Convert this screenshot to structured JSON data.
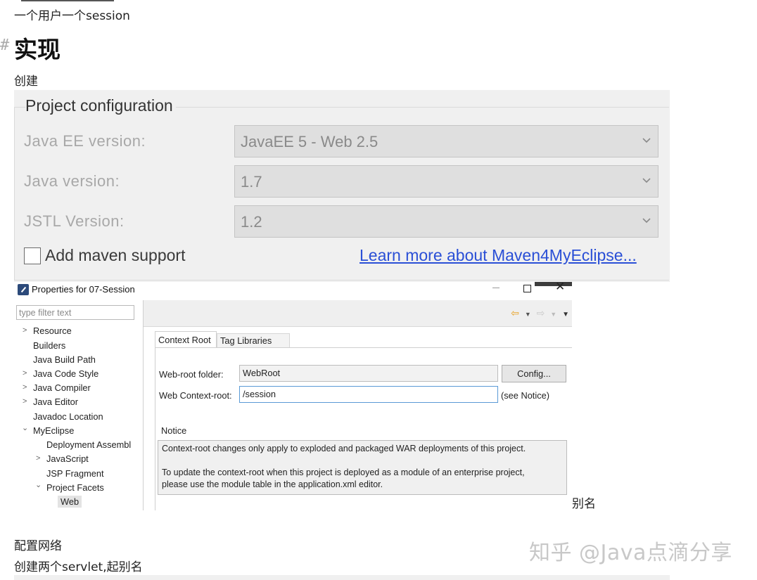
{
  "article": {
    "line_top": "一个用户一个session",
    "heading_hash": "#",
    "heading": "实现",
    "create": "创建",
    "alias_suffix": "别名",
    "configure_network": "配置网络",
    "create_servlets": "创建两个servlet,起别名",
    "watermark": "知乎 @Java点滴分享"
  },
  "project_config": {
    "title": "Project configuration",
    "rows": [
      {
        "label": "Java EE version:",
        "value": "JavaEE 5 - Web 2.5"
      },
      {
        "label": "Java version:",
        "value": "1.7"
      },
      {
        "label": "JSTL Version:",
        "value": "1.2"
      }
    ],
    "maven_checkbox_label": "Add maven support",
    "maven_checked": false,
    "learn_more_link": "Learn more about Maven4MyEclipse..."
  },
  "properties_dialog": {
    "title": "Properties for 07-Session",
    "window_controls": {
      "minimize": "–",
      "maximize": "□",
      "close": "✕"
    },
    "filter_placeholder": "type filter text",
    "tree": [
      {
        "label": "Resource",
        "arrow": ">"
      },
      {
        "label": "Builders",
        "arrow": ""
      },
      {
        "label": "Java Build Path",
        "arrow": ""
      },
      {
        "label": "Java Code Style",
        "arrow": ">"
      },
      {
        "label": "Java Compiler",
        "arrow": ">"
      },
      {
        "label": "Java Editor",
        "arrow": ">"
      },
      {
        "label": "Javadoc Location",
        "arrow": ""
      },
      {
        "label": "MyEclipse",
        "arrow": "⌄"
      },
      {
        "label": "Deployment Assembl",
        "arrow": ""
      },
      {
        "label": "JavaScript",
        "arrow": ">"
      },
      {
        "label": "JSP Fragment",
        "arrow": ""
      },
      {
        "label": "Project Facets",
        "arrow": "⌄"
      },
      {
        "label": "Web",
        "arrow": ""
      }
    ],
    "selected_item": "Web",
    "nav_icons": [
      "back-arrow-icon",
      "dropdown-icon",
      "forward-arrow-icon",
      "dropdown-icon",
      "menu-icon"
    ],
    "tabs": [
      {
        "label": "Context Root"
      },
      {
        "label": "Tag Libraries"
      }
    ],
    "web_root_label": "Web-root folder:",
    "web_root_value": "WebRoot",
    "config_button": "Config...",
    "context_root_label": "Web Context-root:",
    "context_root_value": "/session",
    "see_notice": "(see Notice)",
    "notice_title": "Notice",
    "notice_line1": "Context-root changes only apply to exploded and packaged WAR deployments of this project.",
    "notice_line2": "To update the context-root when this project is deployed as a module of an enterprise project,",
    "notice_line3": "please use the module table in the application.xml editor.",
    "colors": {
      "link": "#2a4fd6",
      "focus_border": "#5a9ad6",
      "back_arrow": "#e8a020"
    }
  }
}
